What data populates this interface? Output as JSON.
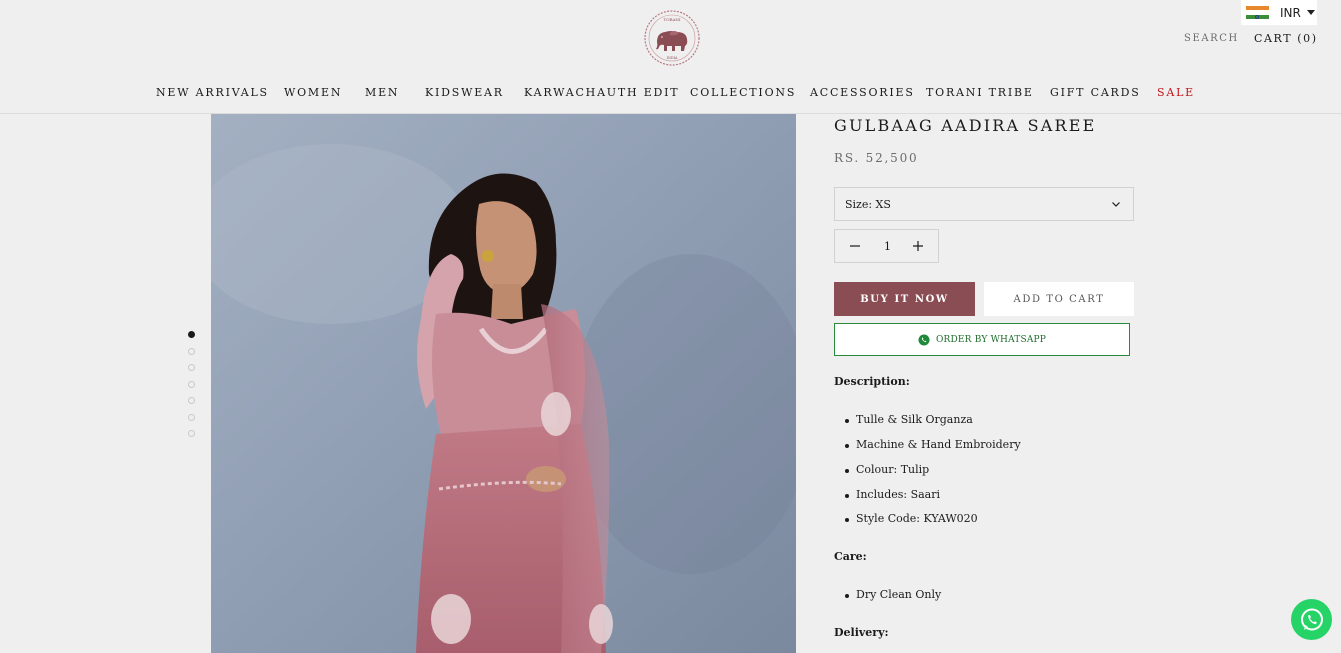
{
  "header": {
    "logo_text_top": "TORANI",
    "logo_text_bottom": "INDIA",
    "currency": "INR",
    "search_label": "SEARCH",
    "cart_label": "CART (0)"
  },
  "nav": {
    "items": [
      {
        "label": "NEW ARRIVALS"
      },
      {
        "label": "WOMEN"
      },
      {
        "label": "MEN"
      },
      {
        "label": "KIDSWEAR"
      },
      {
        "label": "KARWACHAUTH EDIT"
      },
      {
        "label": "COLLECTIONS"
      },
      {
        "label": "ACCESSORIES"
      },
      {
        "label": "TORANI TRIBE"
      },
      {
        "label": "GIFT CARDS"
      },
      {
        "label": "SALE"
      }
    ],
    "sale_color": "#c4151c"
  },
  "gallery": {
    "dot_count": 7,
    "active_index": 0
  },
  "product": {
    "title": "GULBAAG AADIRA SAREE",
    "price": "RS. 52,500",
    "size_value": "Size: XS",
    "quantity": "1",
    "buy_label": "BUY IT NOW",
    "cart_label": "ADD TO CART",
    "whatsapp_label": "ORDER BY WHATSAPP",
    "description_heading": "Description:",
    "description_items": [
      "Tulle & Silk Organza",
      "Machine & Hand Embroidery",
      "Colour: Tulip",
      "Includes: Saari",
      "Style Code: KYAW020"
    ],
    "care_heading": "Care:",
    "care_items": [
      "Dry Clean Only"
    ],
    "delivery_heading": "Delivery:"
  },
  "colors": {
    "accent": "#8b4d54",
    "whatsapp": "#25d366",
    "background": "#efefef"
  }
}
